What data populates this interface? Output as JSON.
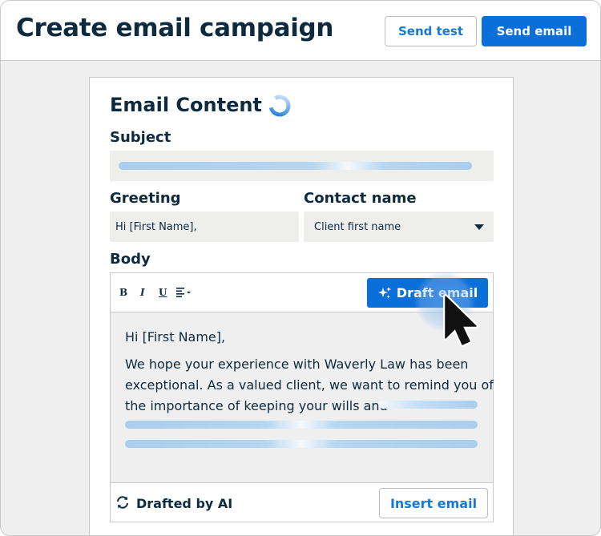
{
  "header": {
    "title": "Create email campaign",
    "send_test_label": "Send test",
    "send_email_label": "Send email"
  },
  "card": {
    "title": "Email Content",
    "loading_icon": "spinner-icon"
  },
  "subject": {
    "label": "Subject",
    "value": ""
  },
  "greeting": {
    "label": "Greeting",
    "value": "Hi [First Name],"
  },
  "contact_name": {
    "label": "Contact name",
    "selected": "Client first name"
  },
  "body": {
    "label": "Body",
    "toolbar": {
      "bold": "B",
      "italic": "I",
      "underline": "U",
      "align_icon": "align-left-icon",
      "draft_label": "Draft email",
      "draft_icon": "sparkle-icon"
    },
    "lines": [
      "Hi [First Name],",
      "We hope your experience with Waverly Law has been",
      "exceptional. As a valued client, we want to remind you of",
      "the importance of keeping your wills and"
    ],
    "footer": {
      "drafted_label": "Drafted by AI",
      "refresh_icon": "refresh-icon",
      "insert_label": "Insert email"
    }
  },
  "colors": {
    "primary": "#0a6fd9",
    "link": "#1778d4",
    "text": "#0d2a3f",
    "field_bg": "#eeeeec",
    "shimmer": "#a9cdee"
  }
}
